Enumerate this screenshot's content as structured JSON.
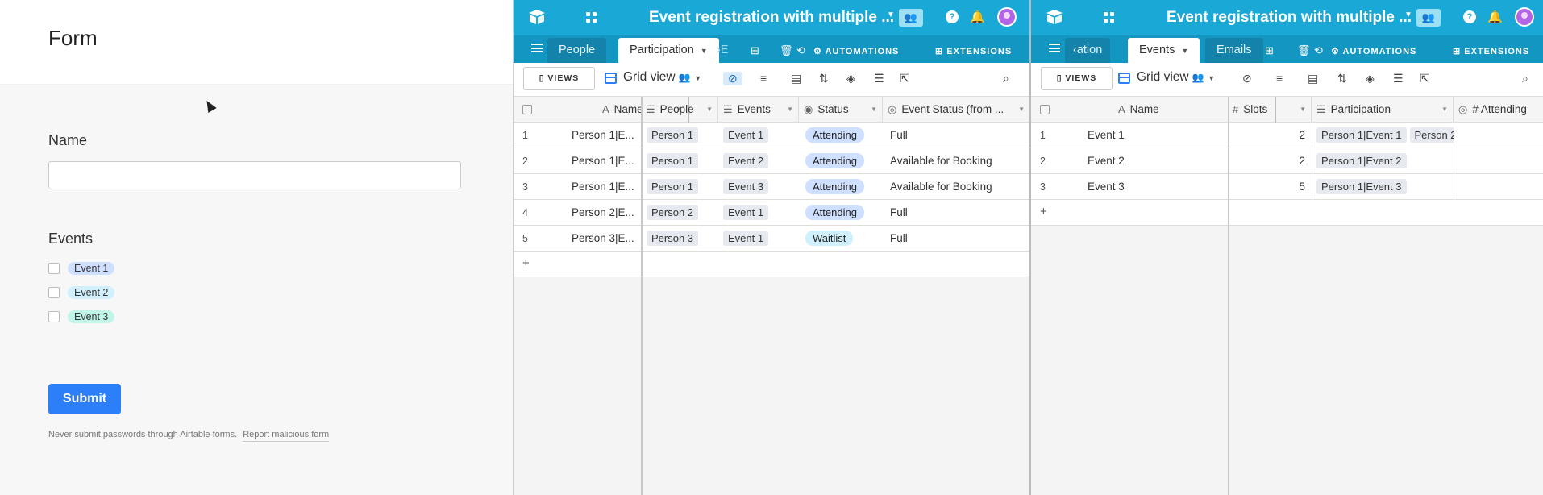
{
  "form": {
    "title": "Form",
    "fields": [
      {
        "label": "Name"
      },
      {
        "label": "Events",
        "options": [
          {
            "label": "Event 1",
            "color": "#cfdfff"
          },
          {
            "label": "Event 2",
            "color": "#d0f0fd"
          },
          {
            "label": "Event 3",
            "color": "#c2f5e9"
          }
        ]
      }
    ],
    "submit_label": "Submit",
    "footer_note": "Never submit passwords through Airtable forms.",
    "report_link": "Report malicious form"
  },
  "base_title": "Event registration with multiple ...",
  "toolbar": {
    "views_label": "VIEWS",
    "grid_view_label": "Grid view",
    "automations_label": "AUTOMATIONS",
    "extensions_label": "EXTENSIONS"
  },
  "base1": {
    "tabs": [
      "People",
      "Participation",
      "E"
    ],
    "columns": [
      "Name",
      "People",
      "Events",
      "Status",
      "Event Status (from ..."
    ],
    "rows": [
      {
        "num": "1",
        "name": "Person 1|E...",
        "people": "Person 1",
        "events": "Event 1",
        "status": "Attending",
        "event_status": "Full"
      },
      {
        "num": "2",
        "name": "Person 1|E...",
        "people": "Person 1",
        "events": "Event 2",
        "status": "Attending",
        "event_status": "Available for Booking"
      },
      {
        "num": "3",
        "name": "Person 1|E...",
        "people": "Person 1",
        "events": "Event 3",
        "status": "Attending",
        "event_status": "Available for Booking"
      },
      {
        "num": "4",
        "name": "Person 2|E...",
        "people": "Person 2",
        "events": "Event 1",
        "status": "Attending",
        "event_status": "Full"
      },
      {
        "num": "5",
        "name": "Person 3|E...",
        "people": "Person 3",
        "events": "Event 1",
        "status": "Waitlist",
        "event_status": "Full"
      }
    ],
    "status_colors": {
      "Attending": "#cfdfff",
      "Waitlist": "#d0f0fd"
    }
  },
  "base2": {
    "tabs": [
      "ation",
      "Events",
      "Emails"
    ],
    "columns": [
      "Name",
      "Slots",
      "Participation",
      "# Attending"
    ],
    "rows": [
      {
        "num": "1",
        "name": "Event 1",
        "slots": "2",
        "participation": [
          "Person 1|Event 1",
          "Person 2"
        ]
      },
      {
        "num": "2",
        "name": "Event 2",
        "slots": "2",
        "participation": [
          "Person 1|Event 2"
        ]
      },
      {
        "num": "3",
        "name": "Event 3",
        "slots": "5",
        "participation": [
          "Person 1|Event 3"
        ]
      }
    ]
  }
}
